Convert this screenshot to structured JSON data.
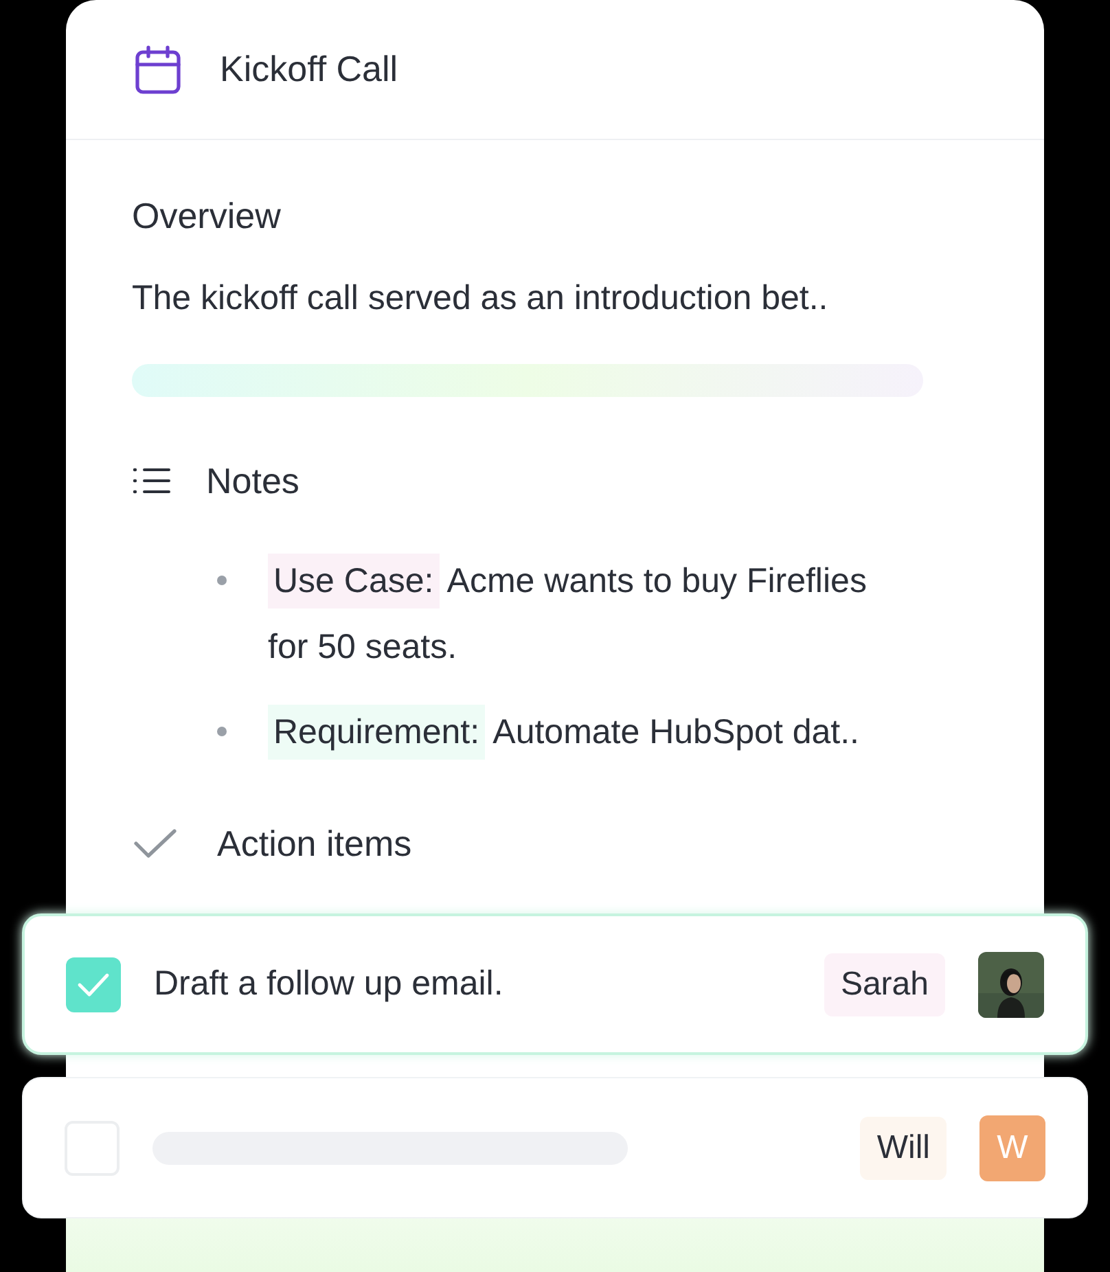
{
  "card": {
    "title": "Kickoff Call"
  },
  "overview": {
    "heading": "Overview",
    "text": "The kickoff call served as an introduction bet.."
  },
  "notes": {
    "heading": "Notes",
    "items": [
      {
        "label": "Use Case:",
        "text": " Acme wants to buy Fireflies for 50 seats.",
        "color": "#fbf1f7"
      },
      {
        "label": "Requirement:",
        "text": " Automate HubSpot dat..",
        "color": "#eefcf6"
      }
    ]
  },
  "action_items": {
    "heading": "Action items",
    "items": [
      {
        "text": "Draft a follow up email.",
        "checked": true,
        "assignee": "Sarah",
        "color": "#fcf2f8"
      },
      {
        "checked": false,
        "assignee": "Will",
        "color": "#fdf6ef",
        "avatar": {
          "kind": "initial",
          "initial": "W"
        }
      }
    ]
  }
}
